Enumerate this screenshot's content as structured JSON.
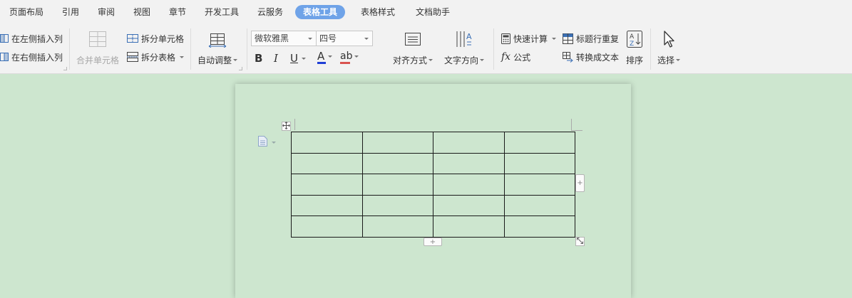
{
  "menu": {
    "tabs": [
      {
        "label": "页面布局"
      },
      {
        "label": "引用"
      },
      {
        "label": "审阅"
      },
      {
        "label": "视图"
      },
      {
        "label": "章节"
      },
      {
        "label": "开发工具"
      },
      {
        "label": "云服务"
      },
      {
        "label": "表格工具"
      },
      {
        "label": "表格样式"
      },
      {
        "label": "文档助手"
      }
    ],
    "active_tab": "表格工具"
  },
  "ribbon": {
    "insert_left": "在左侧插入列",
    "insert_right": "在右侧插入列",
    "merge_cells": "合并单元格",
    "split_cells": "拆分单元格",
    "split_table": "拆分表格",
    "auto_fit": "自动调整",
    "font_name": "微软雅黑",
    "font_size": "四号",
    "bold": "B",
    "italic": "I",
    "underline": "U",
    "font_color_letter": "A",
    "highlight_letter": "ab",
    "align": "对齐方式",
    "text_direction": "文字方向",
    "quick_calc": "快速计算",
    "formula": "公式",
    "fx_symbol": "fx",
    "repeat_header": "标题行重复",
    "convert_text": "转换成文本",
    "sort": "排序",
    "select": "选择",
    "text_dir_glyph": "A"
  },
  "document": {
    "table": {
      "rows": 5,
      "cols": 4
    },
    "add_symbol": "+"
  },
  "colors": {
    "active_tab": "#6fa3e8",
    "font_color": "#1f3fd6",
    "highlight": "#d9534f",
    "background": "#cde6cf",
    "toolbar": "#f2f2f2"
  }
}
